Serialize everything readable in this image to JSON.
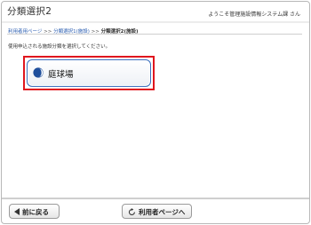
{
  "header": {
    "title": "分類選択2",
    "welcome": "ようこそ管理施設情報システム課 さん"
  },
  "breadcrumb": {
    "items": [
      "利用者用ページ",
      "分類選択1(施設)",
      "分類選択2(施設)"
    ],
    "separator": ">>"
  },
  "instruction": "使用申込される施設分類を選択してください。",
  "categories": [
    {
      "label": "庭球場",
      "icon": "tennis-ball-icon"
    }
  ],
  "footer": {
    "back_label": "前に戻る",
    "back_icon": "left-triangle-icon",
    "user_page_label": "利用者ページへ",
    "user_page_icon": "refresh-arrow-icon"
  },
  "colors": {
    "highlight": "#e0161e",
    "button_border": "#3a6fbd",
    "link": "#2a5db0"
  }
}
